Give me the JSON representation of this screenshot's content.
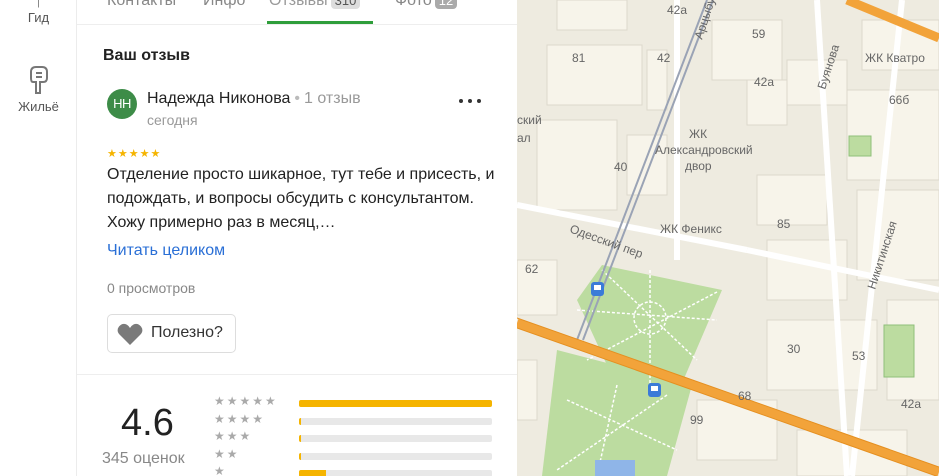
{
  "rail": {
    "guide_label": "Гид",
    "housing_label": "Жильё"
  },
  "tabs": [
    {
      "label": "Контакты"
    },
    {
      "label": "Инфо"
    },
    {
      "label": "Отзывы",
      "badge": "310",
      "active": true
    },
    {
      "label": "Фото",
      "badge": "12"
    }
  ],
  "review": {
    "section_title": "Ваш отзыв",
    "avatar_initials": "НН",
    "author": "Надежда Никонова",
    "author_reviews": "1 отзыв",
    "date": "сегодня",
    "stars": "★★★★★",
    "text": "Отделение просто шикарное, тут тебе и присесть, и подождать, и вопросы обсудить с консультантом. Хожу примерно раз в месяц,…",
    "read_more": "Читать целиком",
    "views": "0 просмотров",
    "useful_label": "Полезно?"
  },
  "summary": {
    "rating": "4.6",
    "count_label": "345 оценок",
    "distribution": [
      {
        "stars": "★★★★★",
        "fraction": 1.0
      },
      {
        "stars": "★★★★",
        "fraction": 0.01
      },
      {
        "stars": "★★★",
        "fraction": 0.01
      },
      {
        "stars": "★★",
        "fraction": 0.01
      },
      {
        "stars": "★",
        "fraction": 0.14
      }
    ]
  },
  "map": {
    "labels": [
      {
        "text": "42а"
      },
      {
        "text": "Арцыбушевская"
      },
      {
        "text": "59"
      },
      {
        "text": "81"
      },
      {
        "text": "42"
      },
      {
        "text": "Буянова"
      },
      {
        "text": "ЖК Кватро"
      },
      {
        "text": "42а"
      },
      {
        "text": "66б"
      },
      {
        "text": "ЖК"
      },
      {
        "text": "Александровский"
      },
      {
        "text": "двор"
      },
      {
        "text": "40"
      },
      {
        "text": "85"
      },
      {
        "text": "Никитинская"
      },
      {
        "text": "ЖК Феникс"
      },
      {
        "text": "Одесский пер"
      },
      {
        "text": "62"
      },
      {
        "text": "30"
      },
      {
        "text": "53"
      },
      {
        "text": "68"
      },
      {
        "text": "99"
      },
      {
        "text": "42а"
      },
      {
        "text": "ский"
      },
      {
        "text": "ал"
      }
    ]
  },
  "colors": {
    "accent_green": "#2f9e3b",
    "link_blue": "#2a6fd6",
    "star_yellow": "#f5b400",
    "avatar_green": "#3d8c48",
    "road_orange": "#f2a33a",
    "park_green": "#bcdca0"
  },
  "icons": {
    "guide": "guide-icon",
    "housing": "housing-icon",
    "more": "more-dots-icon",
    "heart": "heart-icon",
    "transit": "bus-stop-icon"
  }
}
